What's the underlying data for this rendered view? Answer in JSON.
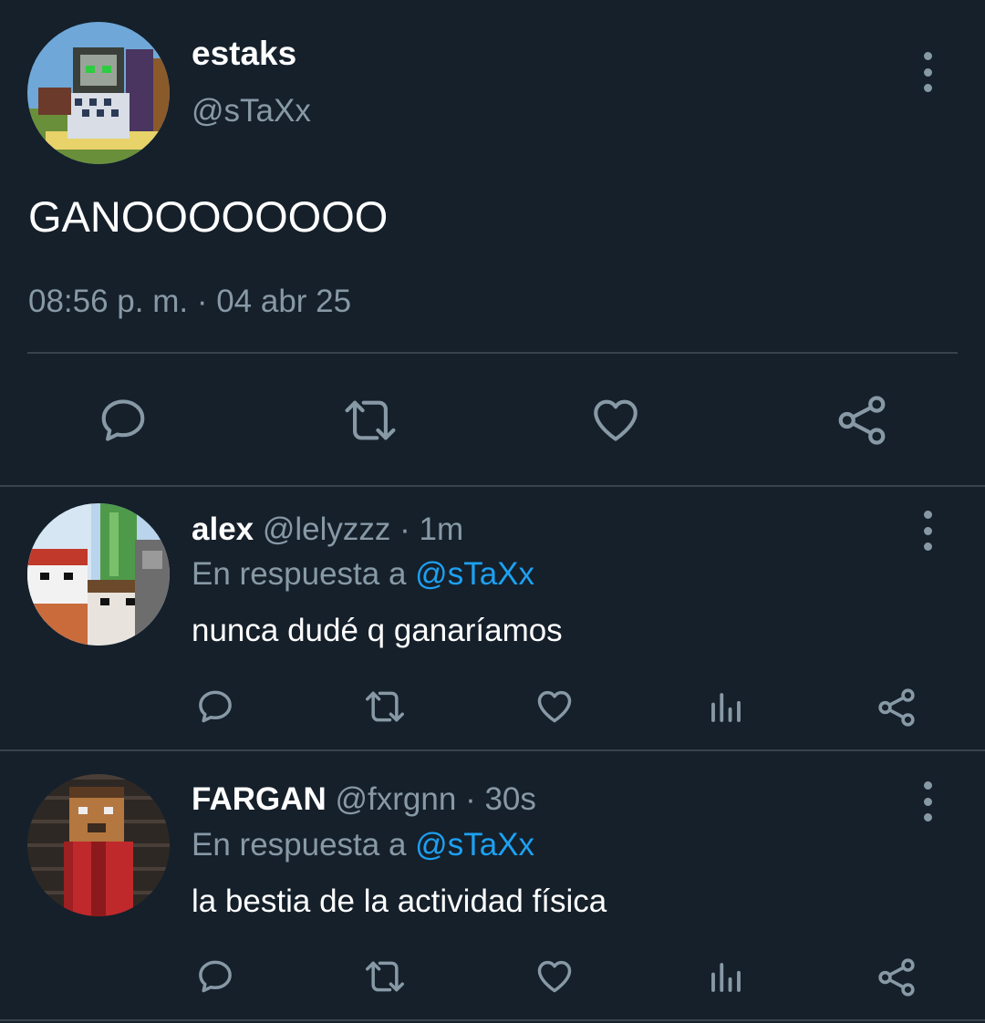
{
  "main_tweet": {
    "display_name": "estaks",
    "handle": "@sTaXx",
    "text": "GANOOOOOOOO",
    "timestamp": "08:56 p. m. · 04 abr 25",
    "actions": [
      "reply-icon",
      "retweet-icon",
      "like-icon",
      "share-icon"
    ]
  },
  "replies": [
    {
      "display_name": "alex",
      "handle": "@lelyzzz",
      "time": "· 1m",
      "reply_prefix": "En respuesta a",
      "reply_to": "@sTaXx",
      "text": "nunca dudé q ganaríamos"
    },
    {
      "display_name": "FARGAN",
      "handle": "@fxrgnn",
      "time": "· 30s",
      "reply_prefix": "En respuesta a",
      "reply_to": "@sTaXx",
      "text": "la bestia de la actividad física"
    }
  ],
  "colors": {
    "background": "#15202b",
    "muted": "#8899a6",
    "accent": "#1da1f2",
    "divider": "#38444d"
  }
}
